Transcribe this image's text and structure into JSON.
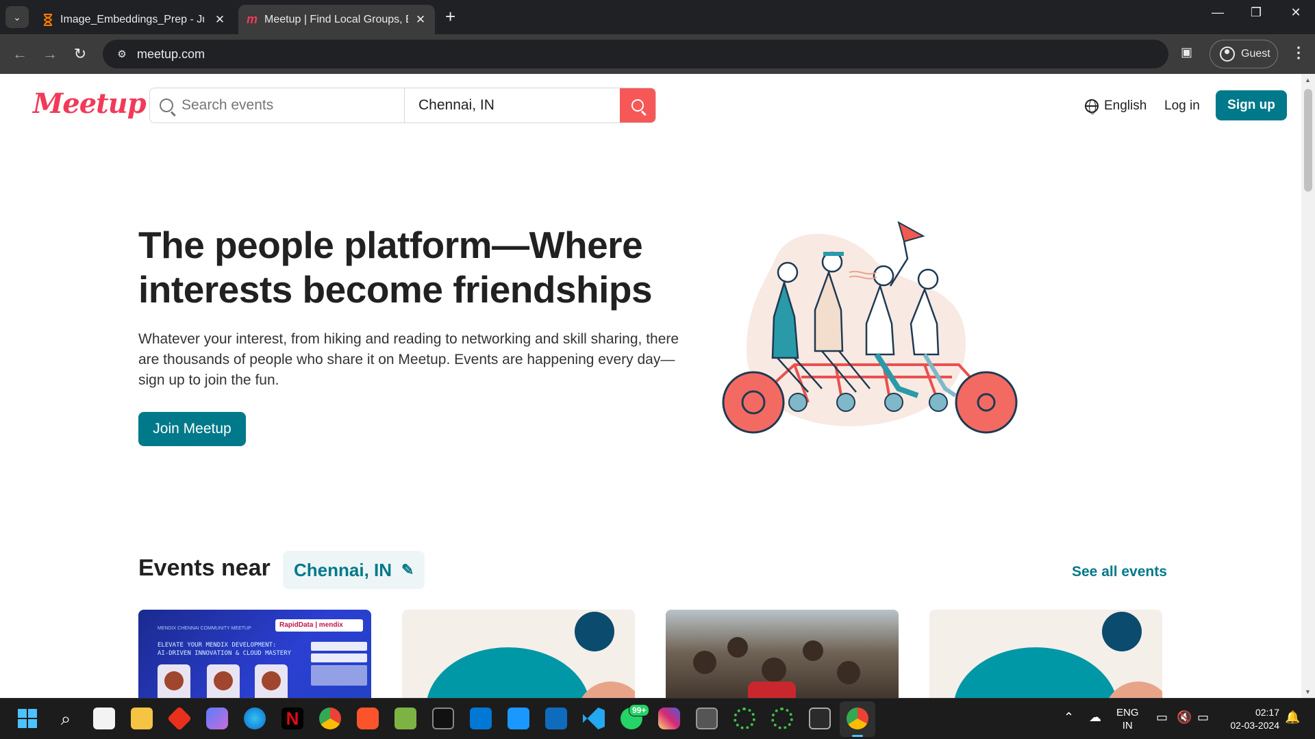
{
  "browser": {
    "tabs": [
      {
        "title": "Image_Embeddings_Prep - Jupyter",
        "active": false,
        "icon": "hourglass-icon"
      },
      {
        "title": "Meetup | Find Local Groups, Events",
        "active": true,
        "icon": "meetup-icon"
      }
    ],
    "url": "meetup.com",
    "profile_label": "Guest"
  },
  "header": {
    "logo": "Meetup",
    "search_placeholder": "Search events",
    "location": "Chennai, IN",
    "language": "English",
    "login": "Log in",
    "signup": "Sign up"
  },
  "hero": {
    "title": "The people platform—Where interests become friendships",
    "text": "Whatever your interest, from hiking and reading to networking and skill sharing, there are thousands of people who share it on Meetup. Events are happening every day—sign up to join the fun.",
    "cta": "Join Meetup"
  },
  "events": {
    "heading": "Events near",
    "location": "Chennai, IN",
    "see_all": "See all events",
    "card1": {
      "top_label": "MENDIX CHENNAI COMMUNITY MEETUP",
      "title_line1": "ELEVATE YOUR MENDIX DEVELOPMENT:",
      "title_line2": "AI-DRIVEN INNOVATION & CLOUD MASTERY",
      "brand": "RapidData | mendix"
    }
  },
  "taskbar": {
    "lang_line1": "ENG",
    "lang_line2": "IN",
    "time": "02:17",
    "date": "02-03-2024",
    "whatsapp_badge": "99+"
  },
  "colors": {
    "brand_red": "#f13a59",
    "teal": "#00798a",
    "search_red": "#f65858"
  }
}
